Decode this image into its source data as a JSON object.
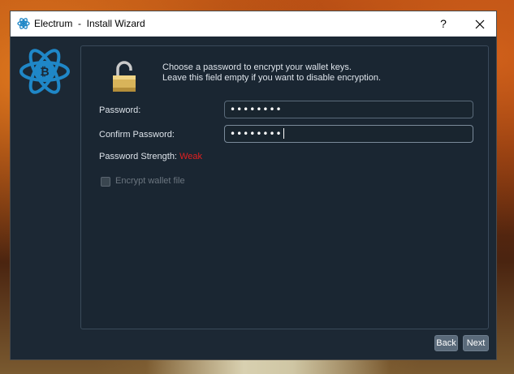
{
  "window": {
    "title": "Electrum  -  Install Wizard",
    "help_label": "?"
  },
  "intro": {
    "line1": "Choose a password to encrypt your wallet keys.",
    "line2": "Leave this field empty if you want to disable encryption."
  },
  "form": {
    "password_label": "Password:",
    "password_value": "••••••••",
    "confirm_label": "Confirm Password:",
    "confirm_value": "••••••••",
    "strength_label": "Password Strength:",
    "strength_value": "Weak",
    "encrypt_label": "Encrypt wallet file",
    "encrypt_checked": false
  },
  "buttons": {
    "back": "Back",
    "next": "Next"
  },
  "colors": {
    "accent": "#1f87c7",
    "weak": "#e02020",
    "window_bg": "#1c2834"
  },
  "icons": [
    "electrum-icon",
    "help-icon",
    "close-icon",
    "electrum-logo",
    "padlock-icon"
  ]
}
